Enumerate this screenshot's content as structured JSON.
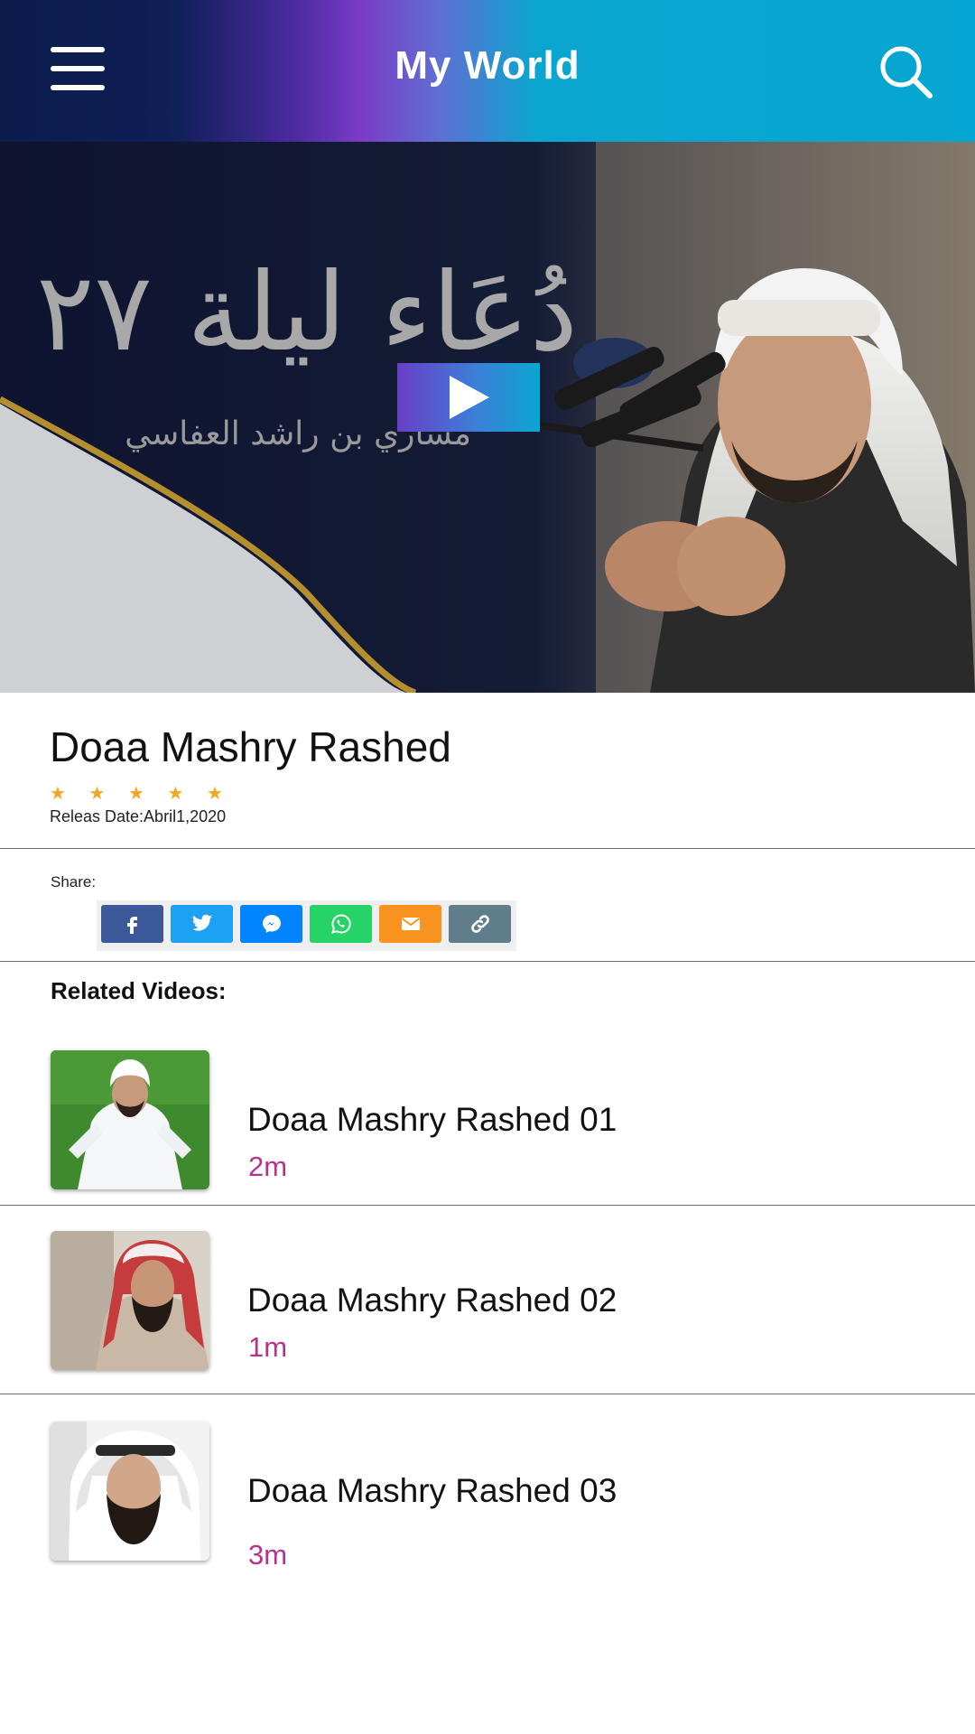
{
  "header": {
    "title": "My World",
    "menu_icon": "hamburger-menu-icon",
    "search_icon": "search-icon"
  },
  "hero": {
    "arabic_title": "دُعَاء ليلة ٢٧",
    "arabic_subtitle": "مشاري بن راشد العفاسي",
    "play_icon": "play-icon"
  },
  "video": {
    "title": "Doaa Mashry Rashed",
    "rating": 5,
    "stars": "★ ★ ★ ★ ★",
    "release": "Releas Date:Abril1,2020"
  },
  "share": {
    "label": "Share:",
    "buttons": [
      {
        "name": "facebook",
        "icon": "facebook-icon",
        "color": "#3b5998"
      },
      {
        "name": "twitter",
        "icon": "twitter-icon",
        "color": "#1da1f2"
      },
      {
        "name": "messenger",
        "icon": "messenger-icon",
        "color": "#0084ff"
      },
      {
        "name": "whatsapp",
        "icon": "whatsapp-icon",
        "color": "#25d366"
      },
      {
        "name": "email",
        "icon": "email-icon",
        "color": "#f7931e"
      },
      {
        "name": "link",
        "icon": "link-icon",
        "color": "#607d8b"
      }
    ]
  },
  "related": {
    "title": "Related Videos:",
    "items": [
      {
        "title": "Doaa Mashry Rashed 01",
        "duration": "2m"
      },
      {
        "title": "Doaa Mashry Rashed 02",
        "duration": "1m"
      },
      {
        "title": "Doaa Mashry Rashed 03",
        "duration": "3m"
      }
    ]
  },
  "colors": {
    "accent": "#b5338a",
    "star": "#f5a623",
    "header_start": "#0b1c4d",
    "header_mid": "#7b3bc7",
    "header_end": "#05a6d1"
  }
}
